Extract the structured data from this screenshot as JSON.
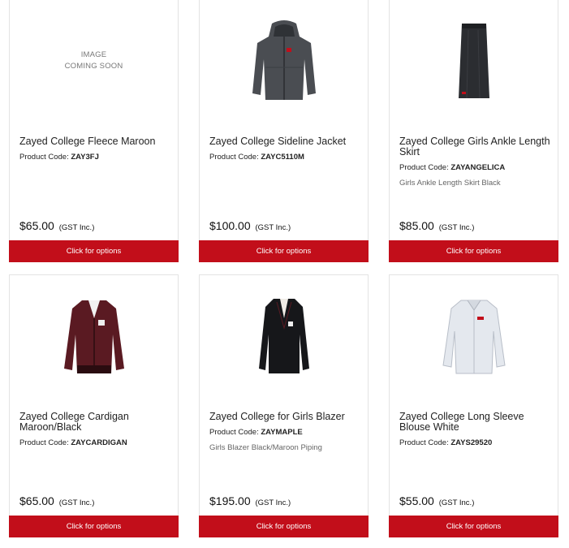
{
  "products": [
    {
      "title": "Zayed College Fleece Maroon",
      "code_label": "Product Code:",
      "code": "ZAY3FJ",
      "desc": "",
      "price": "$65.00",
      "gst": "(GST Inc.)",
      "button": "Click for options",
      "image_text": [
        "IMAGE",
        "COMING SOON"
      ]
    },
    {
      "title": "Zayed College Sideline Jacket",
      "code_label": "Product Code:",
      "code": "ZAYC5110M",
      "desc": "",
      "price": "$100.00",
      "gst": "(GST Inc.)",
      "button": "Click for options"
    },
    {
      "title": "Zayed College Girls Ankle Length Skirt",
      "code_label": "Product Code:",
      "code": "ZAYANGELICA",
      "desc": "Girls Ankle Length Skirt Black",
      "price": "$85.00",
      "gst": "(GST Inc.)",
      "button": "Click for options"
    },
    {
      "title": "Zayed College Cardigan Maroon/Black",
      "code_label": "Product Code:",
      "code": "ZAYCARDIGAN",
      "desc": "",
      "price": "$65.00",
      "gst": "(GST Inc.)",
      "button": "Click for options"
    },
    {
      "title": "Zayed College for Girls Blazer",
      "code_label": "Product Code:",
      "code": "ZAYMAPLE",
      "desc": "Girls Blazer Black/Maroon Piping",
      "price": "$195.00",
      "gst": "(GST Inc.)",
      "button": "Click for options"
    },
    {
      "title": "Zayed College Long Sleeve Blouse White",
      "code_label": "Product Code:",
      "code": "ZAYS29520",
      "desc": "",
      "price": "$55.00",
      "gst": "(GST Inc.)",
      "button": "Click for options"
    }
  ],
  "colors": {
    "button_bg": "#c20e1a",
    "border": "#e3e3e3"
  },
  "icons": [
    "image-placeholder",
    "jacket-image",
    "skirt-image",
    "cardigan-image",
    "blazer-image",
    "blouse-image"
  ]
}
